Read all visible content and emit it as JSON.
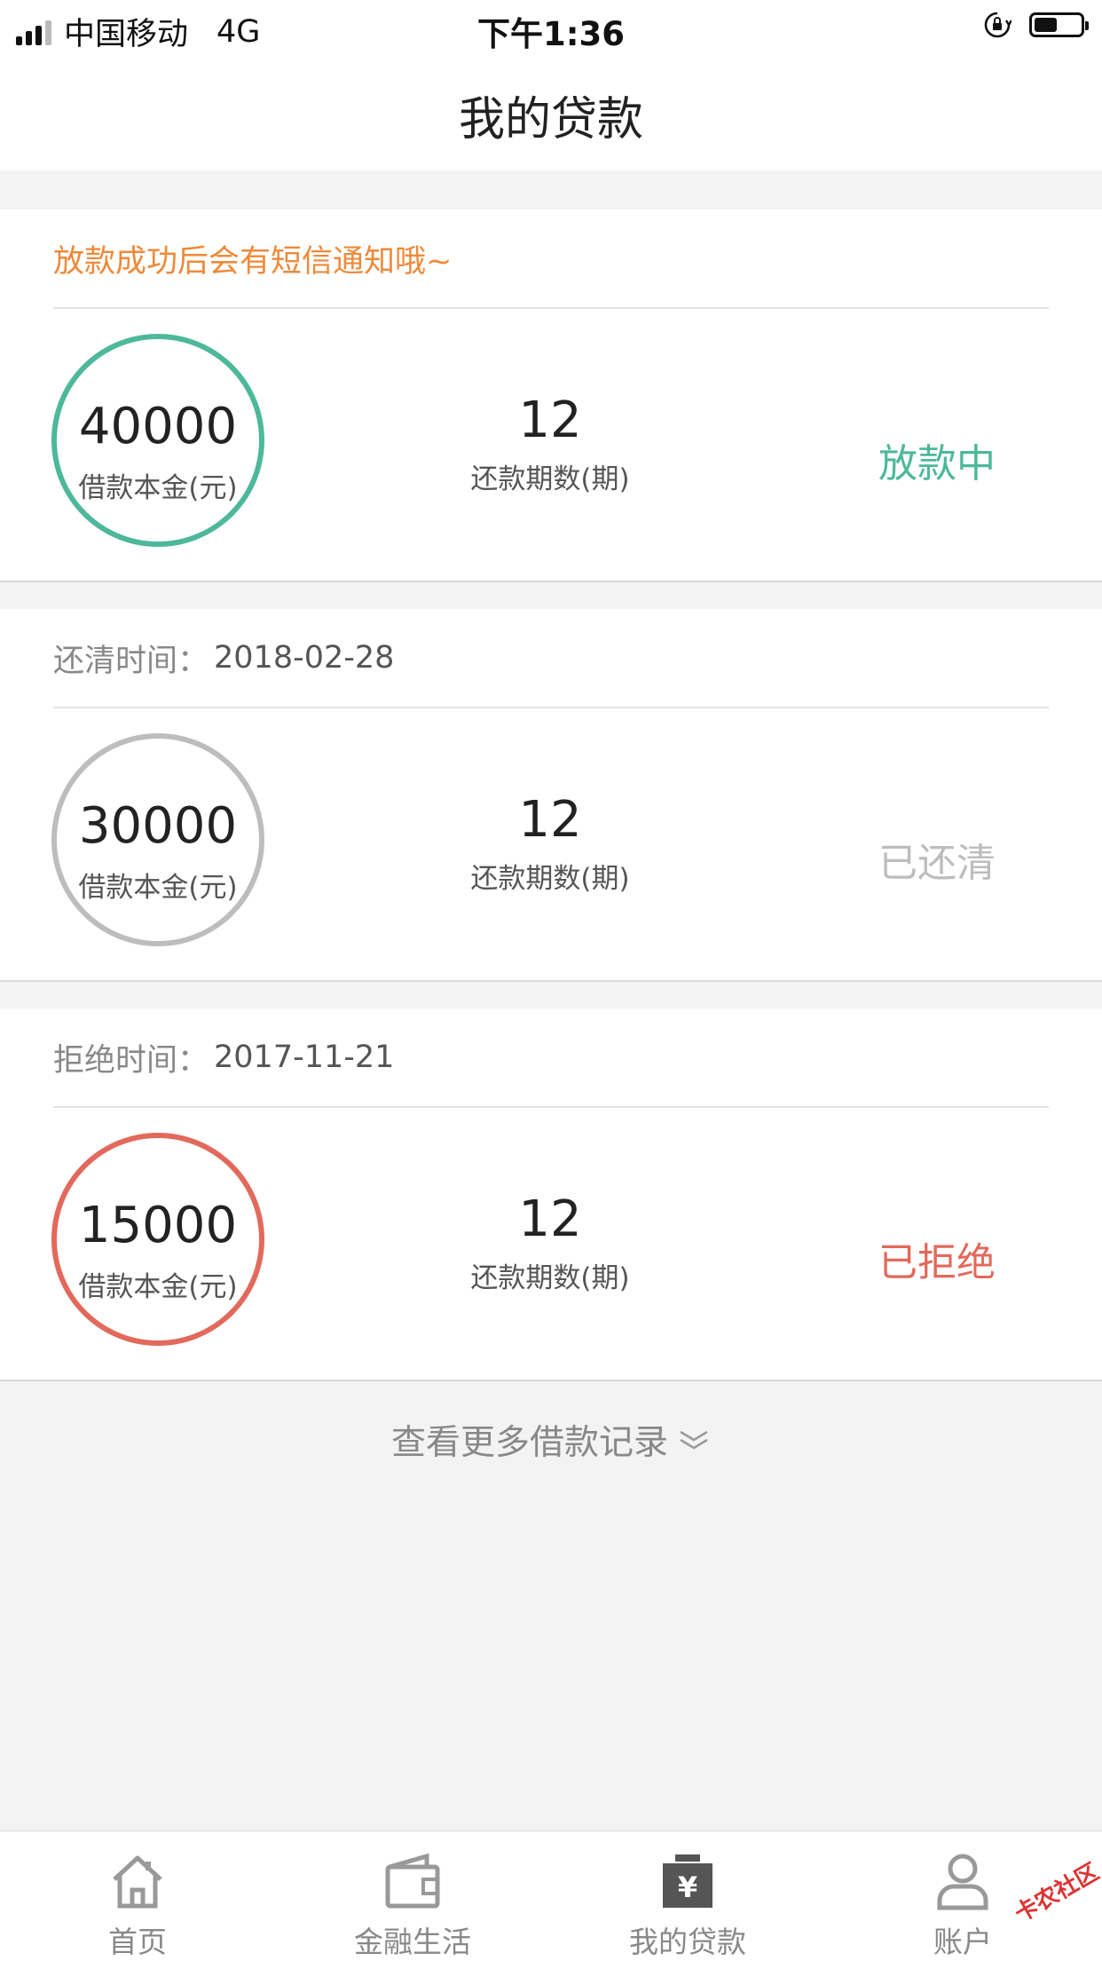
{
  "status_bar": {
    "carrier": "中国移动",
    "network": "4G",
    "time": "下午1:36",
    "icons": [
      "signal-icon",
      "orientation-lock-icon",
      "battery-icon"
    ],
    "battery_level": 0.5
  },
  "nav": {
    "title": "我的贷款"
  },
  "colors": {
    "disbursing": "#4db89a",
    "paid": "#bdbdbd",
    "rejected": "#e2695c",
    "notice": "#ee8a3a"
  },
  "loans": [
    {
      "header_text": "放款成功后会有短信通知哦~",
      "amount": "40000",
      "amount_label": "借款本金(元)",
      "terms": "12",
      "terms_label": "还款期数(期)",
      "status": "放款中"
    },
    {
      "header_label": "还清时间：",
      "header_value": "2018-02-28",
      "amount": "30000",
      "amount_label": "借款本金(元)",
      "terms": "12",
      "terms_label": "还款期数(期)",
      "status": "已还清"
    },
    {
      "header_label": "拒绝时间：",
      "header_value": "2017-11-21",
      "amount": "15000",
      "amount_label": "借款本金(元)",
      "terms": "12",
      "terms_label": "还款期数(期)",
      "status": "已拒绝"
    }
  ],
  "more_link": {
    "label": "查看更多借款记录",
    "icon": "chevron-down-icon"
  },
  "tab_bar": {
    "items": [
      {
        "label": "首页",
        "icon": "home-icon"
      },
      {
        "label": "金融生活",
        "icon": "wallet-icon"
      },
      {
        "label": "我的贷款",
        "icon": "loan-box-icon",
        "active": true
      },
      {
        "label": "账户",
        "icon": "person-icon"
      }
    ]
  },
  "watermark": "卡农社区"
}
